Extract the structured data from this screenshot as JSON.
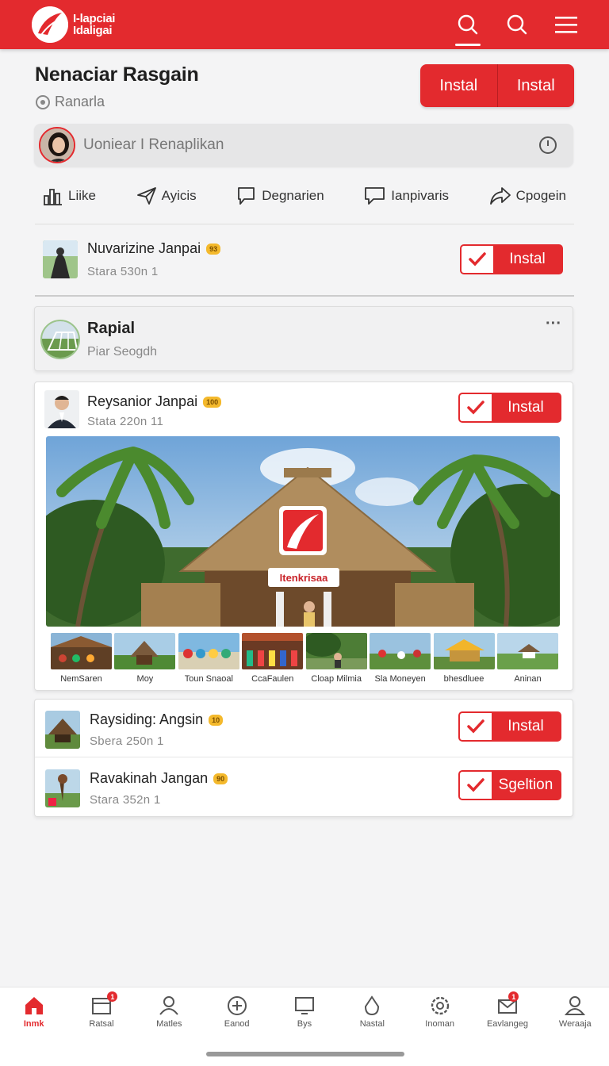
{
  "app": {
    "title_line1": "I-lapciai",
    "title_line2": "Idaligai"
  },
  "header": {
    "title": "Nenaciar Rasgain",
    "subtitle": "Ranarla",
    "btn_left": "Instal",
    "btn_right": "Instal"
  },
  "search": {
    "placeholder": "Uoniear I Renaplikan"
  },
  "actions": [
    {
      "label": "Liike",
      "icon": "bar-chart-icon"
    },
    {
      "label": "Ayicis",
      "icon": "send-icon"
    },
    {
      "label": "Degnarien",
      "icon": "comment-icon"
    },
    {
      "label": "Ianpivaris",
      "icon": "chat-icon"
    },
    {
      "label": "Cpogein",
      "icon": "share-icon"
    }
  ],
  "row1": {
    "name": "Nuvarizine Janpai",
    "badge": "93",
    "meta": "Stara 530n  1",
    "button": "Instal"
  },
  "rapial": {
    "title": "Rapial",
    "subtitle": "Piar Seogdh",
    "more": "···"
  },
  "post": {
    "name": "Reysanior Janpai",
    "badge": "100",
    "meta": "Stata 220n 11",
    "button": "Instal",
    "sign": "Itenkrisaa",
    "gallery": [
      "NemSaren",
      "Moy",
      "Toun Snaoal",
      "CcaFaulen",
      "Cloap Milmia",
      "Sla Moneyen",
      "bhesdluee",
      "Aninan"
    ]
  },
  "row3": {
    "name": "Raysiding: Angsin",
    "badge": "10",
    "meta": "Sbera 250n  1",
    "button": "Instal"
  },
  "row4": {
    "name": "Ravakinah Jangan",
    "badge": "90",
    "meta": "Stara 352n  1",
    "button": "Sgeltion"
  },
  "nav": [
    {
      "label": "Inmk",
      "icon": "home-icon",
      "badge": ""
    },
    {
      "label": "Ratsal",
      "icon": "calendar-icon",
      "badge": "1"
    },
    {
      "label": "Matles",
      "icon": "user-icon",
      "badge": ""
    },
    {
      "label": "Eanod",
      "icon": "plus-circle-icon",
      "badge": ""
    },
    {
      "label": "Bys",
      "icon": "monitor-icon",
      "badge": ""
    },
    {
      "label": "Nastal",
      "icon": "drop-icon",
      "badge": ""
    },
    {
      "label": "Inoman",
      "icon": "gear-icon",
      "badge": ""
    },
    {
      "label": "Eavlangeg",
      "icon": "mail-icon",
      "badge": "1"
    },
    {
      "label": "Weraaja",
      "icon": "profile-icon",
      "badge": ""
    }
  ],
  "colors": {
    "brand": "#e32a2e",
    "background": "#f4f4f5",
    "badge": "#f4b92c"
  }
}
